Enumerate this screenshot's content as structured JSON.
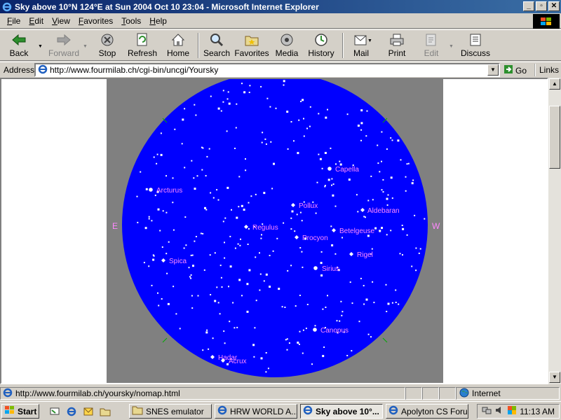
{
  "window": {
    "title": "Sky above 10°N 124°E at Sun 2004 Oct 10 23:04 - Microsoft Internet Explorer",
    "min": "_",
    "max": "▫",
    "close": "✕"
  },
  "menu": [
    "File",
    "Edit",
    "View",
    "Favorites",
    "Tools",
    "Help"
  ],
  "toolbar": {
    "back": "Back",
    "forward": "Forward",
    "stop": "Stop",
    "refresh": "Refresh",
    "home": "Home",
    "search": "Search",
    "favorites": "Favorites",
    "media": "Media",
    "history": "History",
    "mail": "Mail",
    "print": "Print",
    "edit": "Edit",
    "discuss": "Discuss"
  },
  "address": {
    "label": "Address",
    "url": "http://www.fourmilab.ch/cgi-bin/uncgi/Yoursky",
    "go": "Go",
    "links": "Links"
  },
  "sky": {
    "directions": {
      "east": "E",
      "west": "W"
    },
    "colors": {
      "sky": "#0000ff",
      "background": "#808080",
      "labels": "#ff88ff",
      "stars": "#ffffff",
      "horizon_marks": "#00aa00"
    },
    "named_stars": [
      {
        "name": "Capella"
      },
      {
        "name": "Arcturus"
      },
      {
        "name": "Pollux"
      },
      {
        "name": "Aldebaran"
      },
      {
        "name": "Regulus"
      },
      {
        "name": "Betelgeuse"
      },
      {
        "name": "Procyon"
      },
      {
        "name": "Rigel"
      },
      {
        "name": "Spica"
      },
      {
        "name": "Sirius"
      },
      {
        "name": "Canopus"
      },
      {
        "name": "Hadar"
      },
      {
        "name": "Acrux"
      }
    ]
  },
  "status": {
    "url": "http://www.fourmilab.ch/yoursky/nomap.html",
    "zone": "Internet"
  },
  "taskbar": {
    "start": "Start",
    "tasks": [
      {
        "label": "SNES emulator",
        "active": false
      },
      {
        "label": "HRW WORLD A...",
        "active": false
      },
      {
        "label": "Sky above 10°...",
        "active": true
      },
      {
        "label": "Apolyton CS Foru...",
        "active": false
      }
    ],
    "clock": "11:13 AM"
  }
}
